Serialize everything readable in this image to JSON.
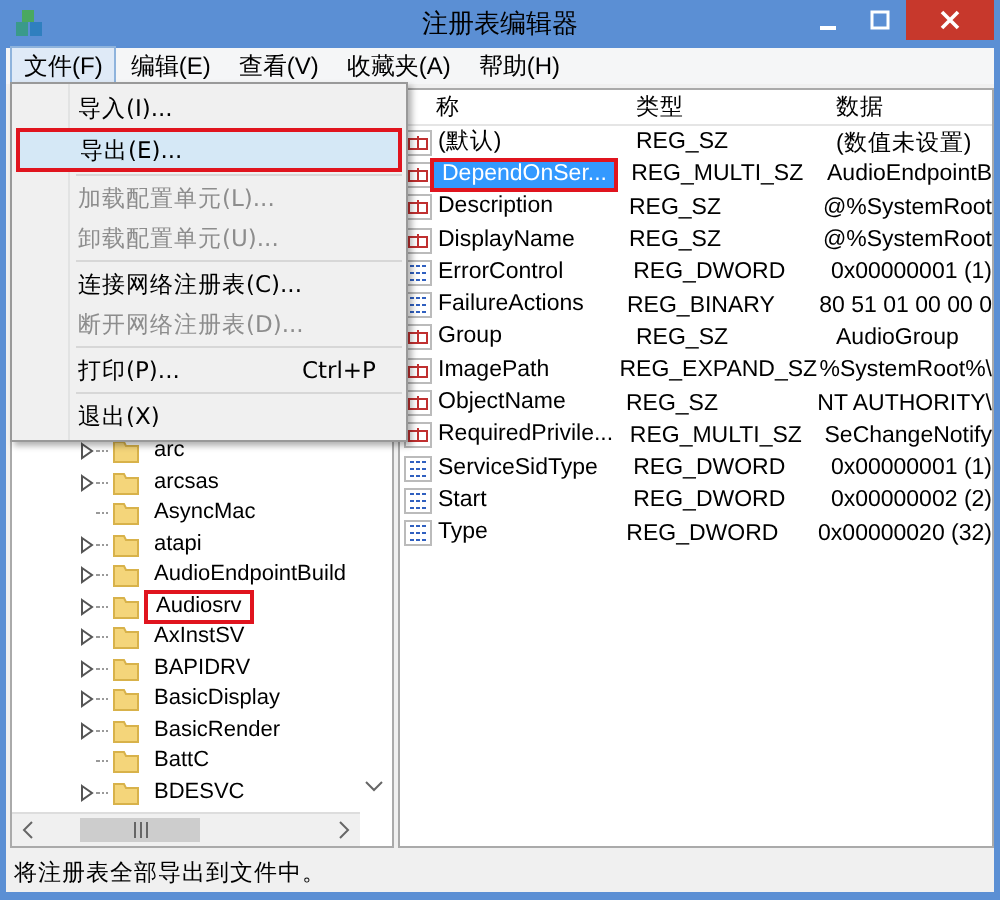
{
  "window": {
    "title": "注册表编辑器"
  },
  "menu_bar": [
    {
      "label": "文件(F)",
      "selected": true
    },
    {
      "label": "编辑(E)",
      "selected": false
    },
    {
      "label": "查看(V)",
      "selected": false
    },
    {
      "label": "收藏夹(A)",
      "selected": false
    },
    {
      "label": "帮助(H)",
      "selected": false
    }
  ],
  "file_menu": [
    {
      "kind": "item",
      "label": "导入(I)...",
      "disabled": false,
      "highlighted": false,
      "annotated": false
    },
    {
      "kind": "item",
      "label": "导出(E)...",
      "disabled": false,
      "highlighted": true,
      "annotated": true
    },
    {
      "kind": "separator"
    },
    {
      "kind": "item",
      "label": "加载配置单元(L)...",
      "disabled": true,
      "highlighted": false,
      "annotated": false
    },
    {
      "kind": "item",
      "label": "卸载配置单元(U)...",
      "disabled": true,
      "highlighted": false,
      "annotated": false
    },
    {
      "kind": "separator"
    },
    {
      "kind": "item",
      "label": "连接网络注册表(C)...",
      "disabled": false,
      "highlighted": false,
      "annotated": false
    },
    {
      "kind": "item",
      "label": "断开网络注册表(D)...",
      "disabled": true,
      "highlighted": false,
      "annotated": false
    },
    {
      "kind": "separator"
    },
    {
      "kind": "item",
      "label": "打印(P)...",
      "shortcut": "Ctrl+P",
      "disabled": false,
      "highlighted": false,
      "annotated": false
    },
    {
      "kind": "separator"
    },
    {
      "kind": "item",
      "label": "退出(X)",
      "disabled": false,
      "highlighted": false,
      "annotated": false
    }
  ],
  "tree": {
    "items": [
      {
        "label": "arc",
        "expandable": true,
        "annotated": false
      },
      {
        "label": "arcsas",
        "expandable": true,
        "annotated": false
      },
      {
        "label": "AsyncMac",
        "expandable": false,
        "annotated": false
      },
      {
        "label": "atapi",
        "expandable": true,
        "annotated": false
      },
      {
        "label": "AudioEndpointBuild",
        "expandable": true,
        "annotated": false
      },
      {
        "label": "Audiosrv",
        "expandable": true,
        "annotated": true
      },
      {
        "label": "AxInstSV",
        "expandable": true,
        "annotated": false
      },
      {
        "label": "BAPIDRV",
        "expandable": true,
        "annotated": false
      },
      {
        "label": "BasicDisplay",
        "expandable": true,
        "annotated": false
      },
      {
        "label": "BasicRender",
        "expandable": true,
        "annotated": false
      },
      {
        "label": "BattC",
        "expandable": false,
        "annotated": false
      },
      {
        "label": "BDESVC",
        "expandable": true,
        "annotated": false
      }
    ]
  },
  "values": {
    "columns": [
      "称",
      "类型",
      "数据"
    ],
    "rows": [
      {
        "kind": "string",
        "name": "(默认)",
        "type": "REG_SZ",
        "data": "(数值未设置)",
        "selected": false,
        "annotated": false
      },
      {
        "kind": "string",
        "name": "DependOnSer...",
        "type": "REG_MULTI_SZ",
        "data": "AudioEndpointB",
        "selected": true,
        "annotated": true
      },
      {
        "kind": "string",
        "name": "Description",
        "type": "REG_SZ",
        "data": "@%SystemRoot",
        "selected": false,
        "annotated": false
      },
      {
        "kind": "string",
        "name": "DisplayName",
        "type": "REG_SZ",
        "data": "@%SystemRoot",
        "selected": false,
        "annotated": false
      },
      {
        "kind": "binary",
        "name": "ErrorControl",
        "type": "REG_DWORD",
        "data": "0x00000001 (1)",
        "selected": false,
        "annotated": false
      },
      {
        "kind": "binary",
        "name": "FailureActions",
        "type": "REG_BINARY",
        "data": "80 51 01 00 00 0",
        "selected": false,
        "annotated": false
      },
      {
        "kind": "string",
        "name": "Group",
        "type": "REG_SZ",
        "data": "AudioGroup",
        "selected": false,
        "annotated": false
      },
      {
        "kind": "string",
        "name": "ImagePath",
        "type": "REG_EXPAND_SZ",
        "data": "%SystemRoot%\\",
        "selected": false,
        "annotated": false
      },
      {
        "kind": "string",
        "name": "ObjectName",
        "type": "REG_SZ",
        "data": "NT AUTHORITY\\",
        "selected": false,
        "annotated": false
      },
      {
        "kind": "string",
        "name": "RequiredPrivile...",
        "type": "REG_MULTI_SZ",
        "data": "SeChangeNotify",
        "selected": false,
        "annotated": false
      },
      {
        "kind": "binary",
        "name": "ServiceSidType",
        "type": "REG_DWORD",
        "data": "0x00000001 (1)",
        "selected": false,
        "annotated": false
      },
      {
        "kind": "binary",
        "name": "Start",
        "type": "REG_DWORD",
        "data": "0x00000002 (2)",
        "selected": false,
        "annotated": false
      },
      {
        "kind": "binary",
        "name": "Type",
        "type": "REG_DWORD",
        "data": "0x00000020 (32)",
        "selected": false,
        "annotated": false
      }
    ]
  },
  "status_bar": "将注册表全部导出到文件中。"
}
